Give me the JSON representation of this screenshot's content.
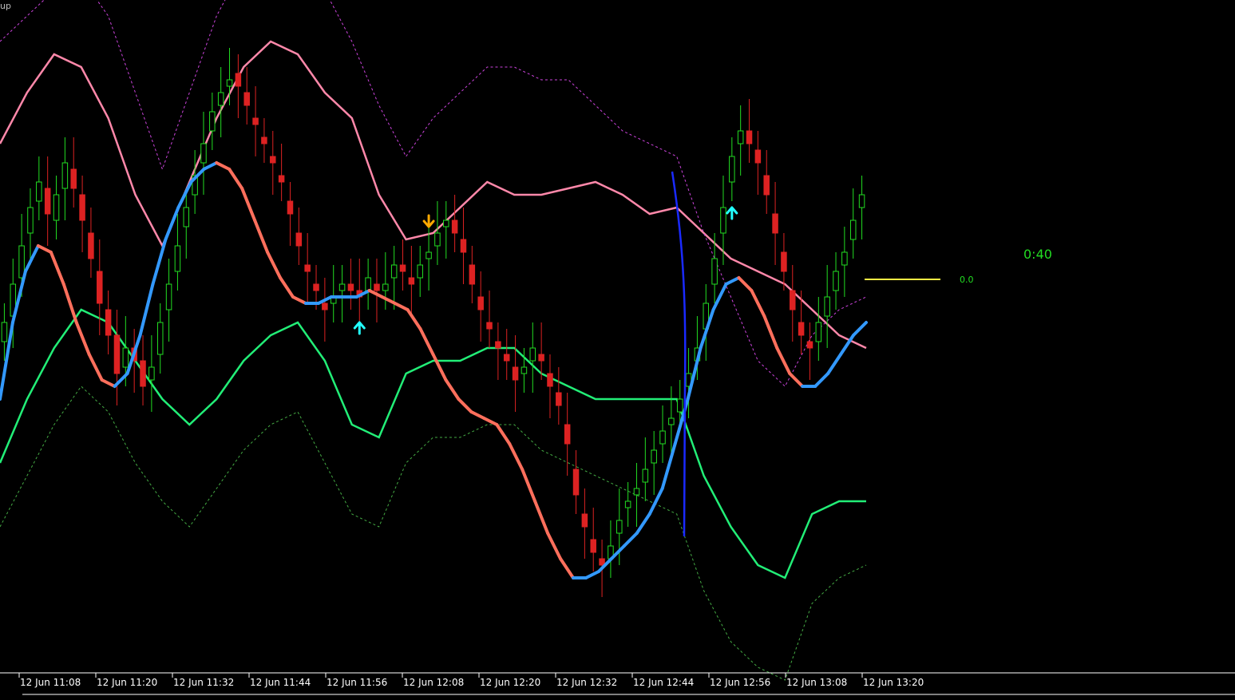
{
  "window": {
    "corner_label": "up"
  },
  "chart_data": {
    "type": "candlestick",
    "symbol": "",
    "timeframe": "M1",
    "x_axis": {
      "tick_labels": [
        "12 Jun 11:08",
        "12 Jun 11:20",
        "12 Jun 11:32",
        "12 Jun 11:44",
        "12 Jun 11:56",
        "12 Jun 12:08",
        "12 Jun 12:20",
        "12 Jun 12:32",
        "12 Jun 12:44",
        "12 Jun 12:56",
        "12 Jun 13:08",
        "12 Jun 13:20"
      ]
    },
    "y_range": [
      0,
      100
    ],
    "candles_close": [
      52,
      58,
      64,
      70,
      74,
      69,
      72,
      77,
      73,
      68,
      62,
      55,
      50,
      44,
      48,
      46,
      42,
      45,
      52,
      58,
      64,
      70,
      75,
      80,
      85,
      88,
      90,
      89,
      86,
      83,
      80,
      77,
      74,
      69,
      64,
      60,
      57,
      54,
      56,
      58,
      57,
      56,
      59,
      57,
      58,
      61,
      60,
      58,
      61,
      63,
      66,
      68,
      66,
      63,
      58,
      54,
      51,
      48,
      46,
      43,
      45,
      48,
      46,
      42,
      39,
      33,
      25,
      20,
      16,
      14,
      17,
      21,
      24,
      26,
      29,
      32,
      35,
      37,
      40,
      44,
      48,
      55,
      62,
      70,
      78,
      82,
      80,
      77,
      72,
      66,
      60,
      54,
      50,
      48,
      52,
      56,
      60,
      63,
      68,
      72
    ],
    "candles_open": [
      49,
      53,
      59,
      66,
      71,
      73,
      68,
      73,
      76,
      72,
      66,
      60,
      54,
      50,
      45,
      48,
      46,
      43,
      47,
      54,
      60,
      67,
      72,
      77,
      82,
      86,
      89,
      91,
      88,
      84,
      81,
      78,
      75,
      71,
      66,
      61,
      58,
      55,
      55,
      57,
      58,
      57,
      57,
      58,
      57,
      59,
      61,
      59,
      59,
      62,
      64,
      67,
      68,
      65,
      61,
      56,
      52,
      49,
      47,
      45,
      44,
      46,
      47,
      44,
      41,
      36,
      29,
      22,
      18,
      15,
      15,
      19,
      23,
      25,
      27,
      30,
      33,
      36,
      38,
      42,
      46,
      51,
      58,
      66,
      74,
      80,
      82,
      79,
      75,
      69,
      63,
      57,
      52,
      49,
      49,
      53,
      57,
      61,
      65,
      70
    ],
    "series": [
      {
        "name": "",
        "color": "#ff6f5c",
        "role": "smoothed-midline",
        "values": [
          40,
          52,
          60,
          64,
          63,
          58,
          52,
          47,
          43,
          42,
          44,
          50,
          58,
          65,
          70,
          74,
          76,
          77,
          76,
          73,
          68,
          63,
          59,
          56,
          55,
          55,
          56,
          56,
          56,
          57,
          56,
          55,
          54,
          51,
          47,
          43,
          40,
          38,
          37,
          36,
          33,
          29,
          24,
          19,
          15,
          12,
          12,
          13,
          15,
          17,
          19,
          22,
          26,
          33,
          40,
          48,
          54,
          58,
          59,
          57,
          53,
          48,
          44,
          42,
          42,
          44,
          47,
          50,
          52
        ]
      },
      {
        "name": "",
        "color": "#ff88aa",
        "role": "upper-band",
        "values": [
          80,
          88,
          94,
          92,
          84,
          72,
          64,
          74,
          84,
          92,
          96,
          94,
          88,
          84,
          72,
          65,
          66,
          70,
          74,
          72,
          72,
          73,
          74,
          72,
          69,
          70,
          66,
          62,
          60,
          58,
          54,
          50,
          48
        ]
      },
      {
        "name": "",
        "color": "#22ee77",
        "role": "lower-band",
        "values": [
          30,
          40,
          48,
          54,
          52,
          46,
          40,
          36,
          40,
          46,
          50,
          52,
          46,
          36,
          34,
          44,
          46,
          46,
          48,
          48,
          44,
          42,
          40,
          40,
          40,
          40,
          28,
          20,
          14,
          12,
          22,
          24,
          24
        ]
      },
      {
        "name": "",
        "color": "#cc44dd",
        "role": "outer-upper-band",
        "values": [
          96,
          100,
          104,
          106,
          100,
          88,
          76,
          88,
          100,
          108,
          112,
          110,
          104,
          96,
          86,
          78,
          84,
          88,
          92,
          92,
          90,
          90,
          86,
          82,
          80,
          78,
          66,
          56,
          46,
          42,
          50,
          54,
          56
        ]
      },
      {
        "name": "",
        "color": "#44aa44",
        "role": "outer-lower-band",
        "values": [
          20,
          28,
          36,
          42,
          38,
          30,
          24,
          20,
          26,
          32,
          36,
          38,
          30,
          22,
          20,
          30,
          34,
          34,
          36,
          36,
          32,
          30,
          28,
          26,
          24,
          22,
          10,
          2,
          -2,
          -4,
          8,
          12,
          14
        ]
      }
    ],
    "signals": [
      {
        "type": "buy-arrow",
        "color": "#22ffff",
        "at": 41
      },
      {
        "type": "sell-arrow",
        "color": "#ffaa00",
        "at": 49
      },
      {
        "type": "buy-arrow",
        "color": "#22ffff",
        "at": 84
      }
    ],
    "annotations": {
      "timer_text": "0:40",
      "level_text": "0.0",
      "level_line_color": "#ffee44",
      "vertical_marker_color": "#1a2aff"
    },
    "colors": {
      "bull": "#22dd22",
      "bear": "#dd2222",
      "background": "#000000",
      "axis": "#ffffff"
    }
  }
}
